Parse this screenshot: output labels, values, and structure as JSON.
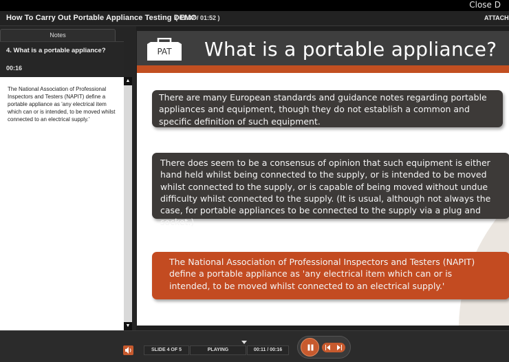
{
  "window": {
    "close_label": "Close D",
    "course_title": "How To Carry Out Portable Appliance Testing DEMO",
    "timecode": "( 01:32 / 01:52 )",
    "attachments_label": "ATTACHM"
  },
  "sidebar": {
    "notes_tab": "Notes",
    "slide_heading": "4. What is a portable appliance?",
    "slide_duration": "00:16",
    "notes_text": "The National Association of Professional Inspectors and Testers (NAPIT) define a portable appliance as 'any electrical item which can or is intended, to be moved whilst connected to an electrical supply.'"
  },
  "slide": {
    "icon_label": "PAT",
    "title": "What is a portable appliance?",
    "callouts": [
      "There are many European standards and guidance notes regarding portable appliances and equipment, though they do not establish a common and specific definition of such equipment.",
      "There does seem to be a consensus of opinion that such equipment is either hand held whilst being connected to the supply, or is intended to be moved whilst connected to the supply, or is capable of being moved without undue difficulty whilst connected to the supply. (It is usual, although not always the case, for portable appliances to be connected to the supply via a plug and socket.)",
      "The National Association of Professional Inspectors and Testers (NAPIT) define a portable appliance as 'any electrical item which can or is intended, to be moved whilst connected to an electrical supply.'"
    ],
    "colors": {
      "header": "#3e3e3e",
      "accent": "#c24f21",
      "callout_dark": "#3d3a38",
      "callout_orange": "#c34b21"
    }
  },
  "player": {
    "slide_counter": "SLIDE 4 OF 5",
    "status": "PLAYING",
    "time": "00:11 / 00:16",
    "icons": [
      "volume-icon",
      "pause-icon",
      "previous-icon",
      "next-icon"
    ]
  }
}
